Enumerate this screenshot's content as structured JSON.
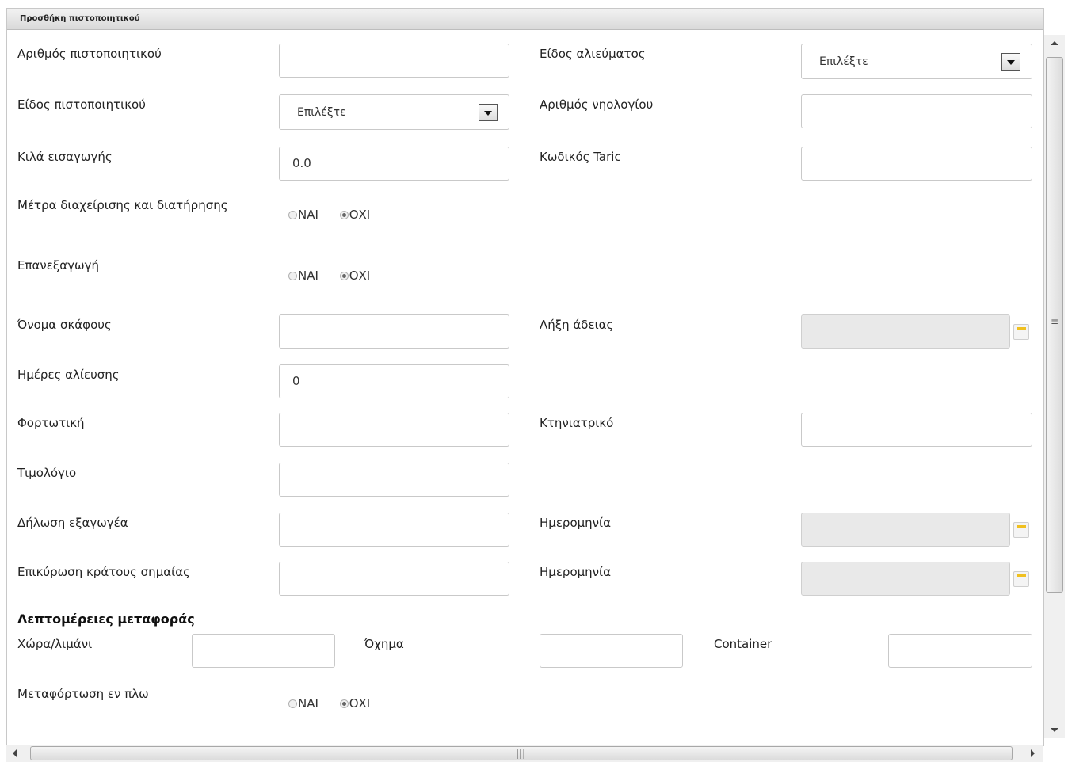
{
  "panel": {
    "title": "Προσθήκη πιστοποιητικού"
  },
  "form": {
    "certificate_number": {
      "label": "Αριθμός πιστοποιητικού",
      "value": ""
    },
    "catch_type": {
      "label": "Είδος αλιεύματος",
      "selected": "Επιλέξτε"
    },
    "certificate_type": {
      "label": "Είδος πιστοποιητικού",
      "selected": "Επιλέξτε"
    },
    "registry_number": {
      "label": "Αριθμός νηολογίου",
      "value": ""
    },
    "import_kilos": {
      "label": "Κιλά εισαγωγής",
      "value": "0.0"
    },
    "taric_code": {
      "label": "Κωδικός Taric",
      "value": ""
    },
    "management_measures": {
      "label": "Μέτρα διαχείρισης και διατήρησης",
      "yes": "ΝΑΙ",
      "no": "ΟΧΙ",
      "selected": "no"
    },
    "reexport": {
      "label": "Επανεξαγωγή",
      "yes": "ΝΑΙ",
      "no": "ΟΧΙ",
      "selected": "no"
    },
    "vessel_name": {
      "label": "Όνομα σκάφους",
      "value": ""
    },
    "license_expiry": {
      "label": "Λήξη άδειας",
      "value": ""
    },
    "fishing_days": {
      "label": "Ημέρες αλίευσης",
      "value": "0"
    },
    "bill_of_lading": {
      "label": "Φορτωτική",
      "value": ""
    },
    "veterinary": {
      "label": "Κτηνιατρικό",
      "value": ""
    },
    "invoice": {
      "label": "Τιμολόγιο",
      "value": ""
    },
    "exporter_declaration": {
      "label": "Δήλωση εξαγωγέα",
      "value": "",
      "date_label": "Ημερομηνία",
      "date_value": ""
    },
    "flag_state_validation": {
      "label": "Επικύρωση κράτους σημαίας",
      "value": "",
      "date_label": "Ημερομηνία",
      "date_value": ""
    }
  },
  "transport": {
    "section_title": "Λεπτομέρειες μεταφοράς",
    "country_port": {
      "label": "Χώρα/λιμάνι",
      "value": ""
    },
    "vehicle": {
      "label": "Όχημα",
      "value": ""
    },
    "container": {
      "label": "Container",
      "value": ""
    },
    "transshipment": {
      "label": "Μεταφόρτωση εν πλω",
      "yes": "ΝΑΙ",
      "no": "ΟΧΙ",
      "selected": "no"
    }
  },
  "icons": {
    "calendar": "calendar-icon",
    "dropdown": "chevron-down-icon"
  },
  "colors": {
    "header_bg": "#e0e0e0",
    "disabled_bg": "#e9e9e9",
    "calendar_accent": "#f0c020"
  }
}
